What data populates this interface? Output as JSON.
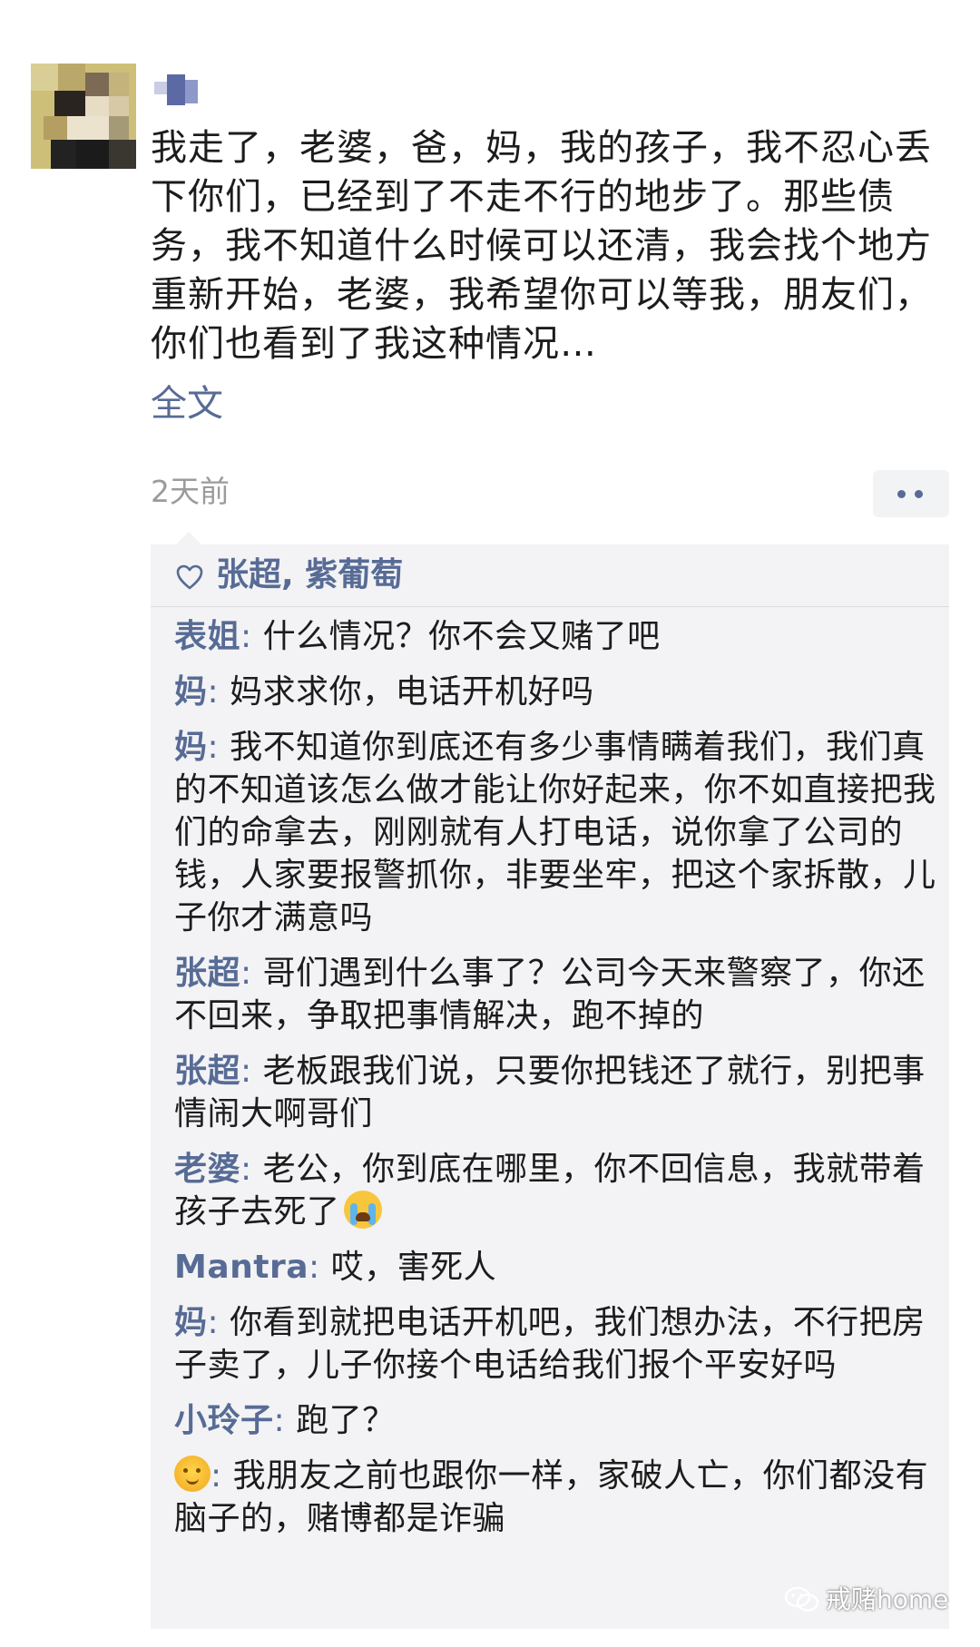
{
  "post": {
    "text": "我走了，老婆，爸，妈，我的孩子，我不忍心丢下你们，已经到了不走不行的地步了。那些债务，我不知道什么时候可以还清，我会找个地方重新开始，老婆，我希望你可以等我，朋友们，你们也看到了我这种情况…",
    "full_text_label": "全文",
    "timestamp": "2天前"
  },
  "likes": {
    "names": "张超, 紫葡萄"
  },
  "comments": [
    {
      "author": "表姐",
      "text": "什么情况？你不会又赌了吧"
    },
    {
      "author": "妈",
      "text": "妈求求你，电话开机好吗"
    },
    {
      "author": "妈",
      "text": "我不知道你到底还有多少事情瞒着我们，我们真的不知道该怎么做才能让你好起来，你不如直接把我们的命拿去，刚刚就有人打电话，说你拿了公司的钱，人家要报警抓你，非要坐牢，把这个家拆散，儿子你才满意吗"
    },
    {
      "author": "张超",
      "text": "哥们遇到什么事了？公司今天来警察了，你还不回来，争取把事情解决，跑不掉的"
    },
    {
      "author": "张超",
      "text": "老板跟我们说，只要你把钱还了就行，别把事情闹大啊哥们"
    },
    {
      "author": "老婆",
      "text": "老公，你到底在哪里，你不回信息，我就带着孩子去死了"
    },
    {
      "author": "Mantra",
      "text": "哎，害死人"
    },
    {
      "author": "妈",
      "text": "你看到就把电话开机吧，我们想办法，不行把房子卖了，儿子你接个电话给我们报个平安好吗"
    },
    {
      "author": "小玲子",
      "text": "跑了？"
    },
    {
      "author": "",
      "text": "我朋友之前也跟你一样，家破人亡，你们都没有脑子的，赌博都是诈骗"
    }
  ],
  "watermark": {
    "text": "戒赌home"
  },
  "colors": {
    "link": "#576b95",
    "comment_bg": "#f3f3f5",
    "timestamp": "#9b9b9b"
  },
  "icons": [
    "avatar",
    "more-icon",
    "heart-icon",
    "sun-emoji",
    "loudly-crying-emoji",
    "wechat-icon"
  ]
}
